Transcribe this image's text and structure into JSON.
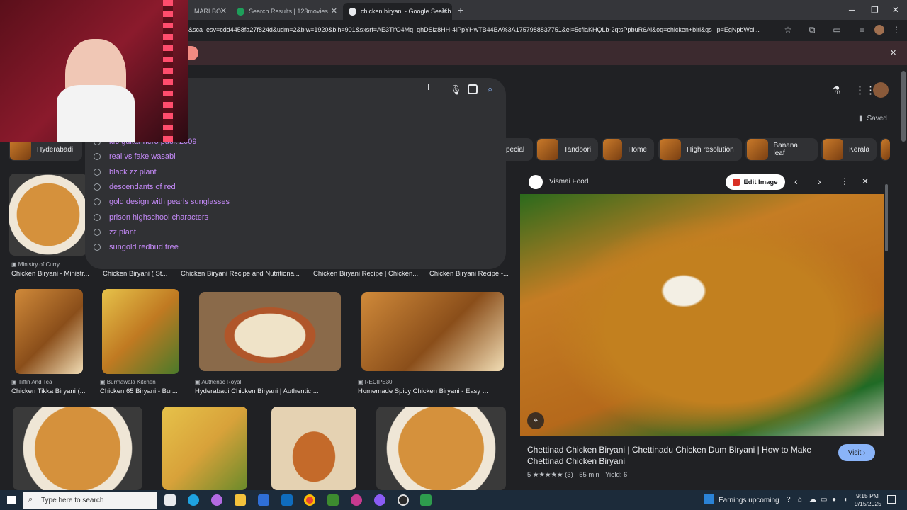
{
  "browser": {
    "tabs": [
      {
        "label": "MARLBO",
        "active": false
      },
      {
        "label": "Search Results | 123movies",
        "active": false
      },
      {
        "label": "chicken biryani - Google Search",
        "active": true
      }
    ],
    "url": "&sca_esv=cdd4458fa27f824d&udm=2&biw=1920&bih=901&sxsrf=AE3TifO4Mq_qhDSlz8HH-4iPpYHwTB44BA%3A1757988837751&ei=5cflaKHQLb-2qtsPpbuR6Al&oq=chicken+biri&gs_lp=EgNpbWci..."
  },
  "search": {
    "suggestions": [
      "kfc guitar hero pack 2009",
      "real vs fake wasabi",
      "black zz plant",
      "descendants of red",
      "gold design with pearls sunglasses",
      "prison highschool characters",
      "zz plant",
      "sungold redbud tree"
    ]
  },
  "header": {
    "saved_label": "Saved"
  },
  "chips": [
    "Hyderabadi",
    "pecial",
    "Tandoori",
    "Home",
    "High resolution",
    "Banana leaf",
    "Kerala"
  ],
  "results": {
    "row1": [
      {
        "source": "Ministry of Curry",
        "caption": "Chicken Biryani - Ministr..."
      },
      {
        "source": "",
        "caption": "Chicken Biryani ( St..."
      },
      {
        "source": "",
        "caption": "Chicken Biryani Recipe and Nutritiona..."
      },
      {
        "source": "",
        "caption": "Chicken Biryani Recipe | Chicken..."
      },
      {
        "source": "",
        "caption": "Chicken Biryani Recipe -..."
      }
    ],
    "row2": [
      {
        "source": "Tiffin And Tea",
        "caption": "Chicken Tikka Biryani (..."
      },
      {
        "source": "Burmawala Kitchen",
        "caption": "Chicken 65 Biryani - Bur..."
      },
      {
        "source": "Authentic Royal",
        "caption": "Hyderabadi Chicken Biryani | Authentic ..."
      },
      {
        "source": "RECIPE30",
        "caption": "Homemade Spicy Chicken Biryani - Easy ..."
      }
    ]
  },
  "panel": {
    "source": "Vismai Food",
    "edit_label": "Edit Image",
    "title": "Chettinad Chicken Biryani | Chettinadu Chicken Dum Biryani | How to Make Chettinad Chicken Biryani",
    "meta": "5 ★★★★★ (3) · 55 min · Yield: 6",
    "visit_label": "Visit ›"
  },
  "taskbar": {
    "search_placeholder": "Type here to search",
    "news": "Earnings upcoming",
    "time": "9:15 PM",
    "date": "9/15/2025"
  }
}
